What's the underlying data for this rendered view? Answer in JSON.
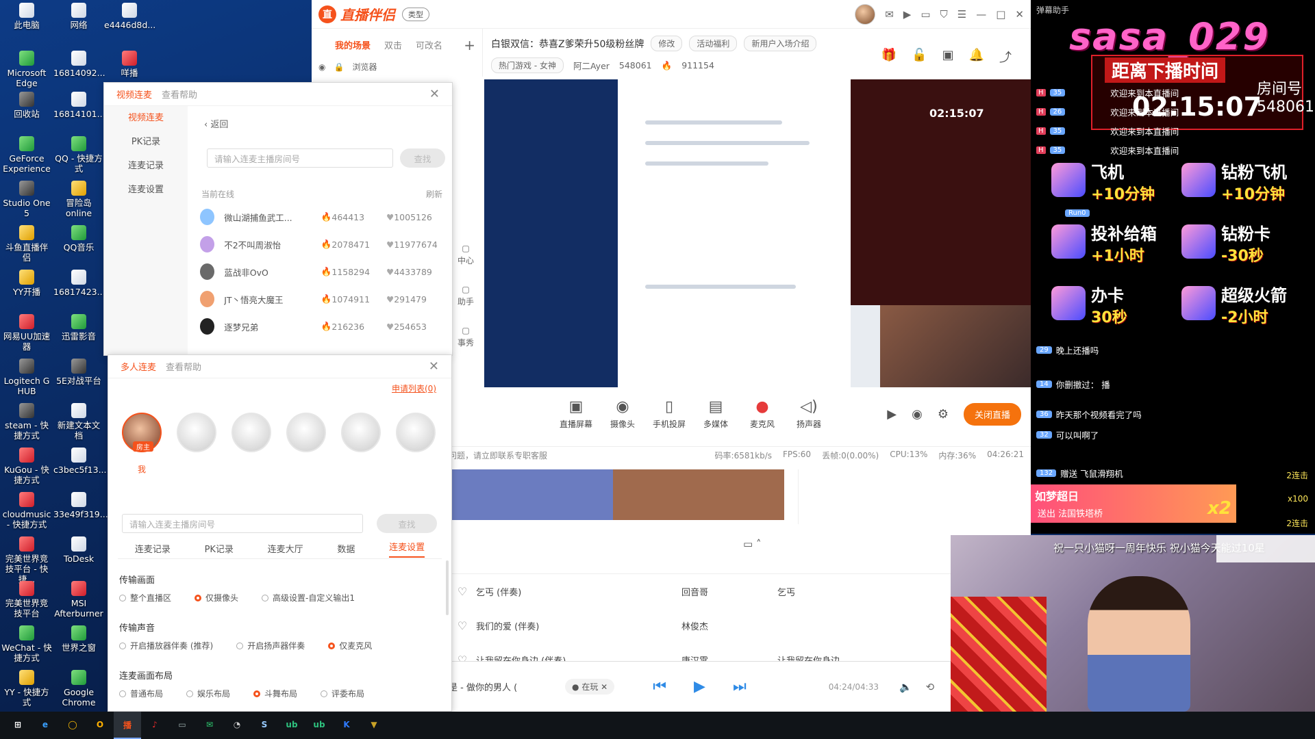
{
  "desktop": {
    "icons": [
      {
        "label": "此电脑",
        "glyph": "💻"
      },
      {
        "label": "网络",
        "glyph": "🌐"
      },
      {
        "label": "e4446d8d...",
        "glyph": "📄"
      },
      {
        "label": "Microsoft Edge",
        "glyph": "e"
      },
      {
        "label": "16814092...",
        "glyph": "📄"
      },
      {
        "label": "咩播",
        "glyph": "🎬"
      },
      {
        "label": "回收站",
        "glyph": "🗑"
      },
      {
        "label": "16814101...",
        "glyph": "📄"
      },
      {
        "label": "GeForce Experience",
        "glyph": "◆"
      },
      {
        "label": "QQ - 快捷方式",
        "glyph": "🐧"
      },
      {
        "label": "Studio One 5",
        "glyph": "◉"
      },
      {
        "label": "冒险岛online",
        "glyph": "⚔"
      },
      {
        "label": "斗鱼直播伴侣",
        "glyph": "🐟"
      },
      {
        "label": "QQ音乐",
        "glyph": "♫"
      },
      {
        "label": "YY开播",
        "glyph": "Y"
      },
      {
        "label": "16817423...",
        "glyph": "📄"
      },
      {
        "label": "网易UU加速器",
        "glyph": "U"
      },
      {
        "label": "迅雷影音",
        "glyph": "▶"
      },
      {
        "label": "Logitech G HUB",
        "glyph": "G"
      },
      {
        "label": "5E对战平台",
        "glyph": "5"
      },
      {
        "label": "steam - 快捷方式",
        "glyph": "S"
      },
      {
        "label": "新建文本文档",
        "glyph": "📄"
      },
      {
        "label": "KuGou - 快捷方式",
        "glyph": "K"
      },
      {
        "label": "c3bec5f13...",
        "glyph": "📄"
      },
      {
        "label": "cloudmusic - 快捷方式",
        "glyph": "♪"
      },
      {
        "label": "33e49f319...",
        "glyph": "📄"
      },
      {
        "label": "完美世界竞技平台 - 快捷...",
        "glyph": "W"
      },
      {
        "label": "ToDesk",
        "glyph": "T"
      },
      {
        "label": "完美世界竞技平台",
        "glyph": "W"
      },
      {
        "label": "MSI Afterburner",
        "glyph": "M"
      },
      {
        "label": "WeChat - 快捷方式",
        "glyph": "W"
      },
      {
        "label": "世界之窗",
        "glyph": "◎"
      },
      {
        "label": "YY - 快捷方式",
        "glyph": "Y"
      },
      {
        "label": "Google Chrome",
        "glyph": "◯"
      }
    ]
  },
  "taskbar": {
    "items": [
      {
        "glyph": "⊞",
        "name": "start-button"
      },
      {
        "glyph": "e",
        "name": "taskbar-edge"
      },
      {
        "glyph": "◯",
        "name": "taskbar-chrome"
      },
      {
        "glyph": "O",
        "name": "taskbar-obs"
      },
      {
        "glyph": "播",
        "name": "taskbar-zhibo"
      },
      {
        "glyph": "♪",
        "name": "taskbar-netease-music"
      },
      {
        "glyph": "▭",
        "name": "taskbar-window"
      },
      {
        "glyph": "✉",
        "name": "taskbar-wechat"
      },
      {
        "glyph": "◔",
        "name": "taskbar-clock-app"
      },
      {
        "glyph": "S",
        "name": "taskbar-steam"
      },
      {
        "glyph": "ub",
        "name": "taskbar-uu-1"
      },
      {
        "glyph": "ub",
        "name": "taskbar-uu-2"
      },
      {
        "glyph": "K",
        "name": "taskbar-kugou"
      },
      {
        "glyph": "▼",
        "name": "taskbar-game"
      }
    ]
  },
  "app": {
    "logo_text": "直播伴侣",
    "type_btn": "类型",
    "scene_tabs": [
      "我的场景",
      "双击",
      "可改名"
    ],
    "scene_row_label": "浏览器",
    "room_title": "白银双信：恭喜Z爹荣升50级粉丝牌",
    "edit_btn": "修改",
    "activity_btn": "活动福利",
    "newuser_btn": "新用户入场介绍",
    "category": "热门游戏 - 女神",
    "host_name": "阿二Ayer",
    "room_id": "548061",
    "popularity": "911154",
    "side_tools": [
      "中心",
      "助手",
      "事秀"
    ],
    "tools": [
      {
        "label": "直播屏幕",
        "glyph": "▣"
      },
      {
        "label": "摄像头",
        "glyph": "◉"
      },
      {
        "label": "手机投屏",
        "glyph": "▯"
      },
      {
        "label": "多媒体",
        "glyph": "▤"
      },
      {
        "label": "麦克风",
        "glyph": "●"
      },
      {
        "label": "扬声器",
        "glyph": "◁)"
      }
    ],
    "end_live": "关闭直播",
    "status_msg": "问题，请立即联系专职客服",
    "status": {
      "bitrate": "码率:6581kb/s",
      "fps": "FPS:60",
      "drop": "丢帧:0(0.00%)",
      "cpu": "CPU:13%",
      "mem": "内存:36%",
      "time": "04:26:21"
    },
    "songs": [
      {
        "name": "乞丐 (伴奏)",
        "artist": "回音哥",
        "album": "乞丐"
      },
      {
        "name": "我们的爱 (伴奏)",
        "artist": "林俊杰",
        "album": ""
      },
      {
        "name": "让我留在你身边 (伴奏)",
        "artist": "唐汉霄",
        "album": "让我留在你身边"
      }
    ],
    "player": {
      "title": "是 - 做你的男人 (",
      "user": "在玩",
      "time": "04:24/04:33"
    }
  },
  "video_link": {
    "title": "视频连麦",
    "help": "查看帮助",
    "nav": [
      "视频连麦",
      "PK记录",
      "连麦记录",
      "连麦设置"
    ],
    "back": "返回",
    "search_placeholder": "请输入连麦主播房间号",
    "search_btn": "查找",
    "online_label": "当前在线",
    "refresh": "刷新",
    "anchors": [
      {
        "name": "微山湖捕鱼武工...",
        "fans": "464413",
        "likes": "1005126",
        "color": "#8ec5ff"
      },
      {
        "name": "不2不叫周淑怡",
        "fans": "2078471",
        "likes": "11977674",
        "color": "#c3a0e8"
      },
      {
        "name": "蓝战非OvO",
        "fans": "1158294",
        "likes": "4433789",
        "color": "#6a6a6a"
      },
      {
        "name": "JT丶悟亮大魔王",
        "fans": "1074911",
        "likes": "291479",
        "color": "#f0a070"
      },
      {
        "name": "逐梦兄弟",
        "fans": "216236",
        "likes": "254653",
        "color": "#222"
      }
    ]
  },
  "multi_link": {
    "title": "多人连麦",
    "help": "查看帮助",
    "request_list": "申请列表(0)",
    "host_badge": "房主",
    "me_label": "我",
    "search_placeholder": "请输入连麦主播房间号",
    "search_btn": "查找",
    "tabs": [
      "连麦记录",
      "PK记录",
      "连麦大厅",
      "数据",
      "连麦设置"
    ],
    "sections": [
      {
        "title": "传输画面",
        "options": [
          "整个直播区",
          "仅摄像头",
          "高级设置-自定义输出1"
        ],
        "selected": 1
      },
      {
        "title": "传输声音",
        "options": [
          "开启播放器伴奏 (推荐)",
          "开启扬声器伴奏",
          "仅麦克风"
        ],
        "selected": 2
      },
      {
        "title": "连麦画面布局",
        "options": [
          "普通布局",
          "娱乐布局",
          "斗舞布局",
          "评委布局"
        ],
        "selected": 2
      }
    ]
  },
  "danmaku": {
    "title": "弹幕助手",
    "overlay_name": "sasa_029",
    "timer_label": "距离下播时间",
    "room_label": "房间号",
    "room_num": "548061",
    "timer": "02:15:07",
    "messages": [
      {
        "lv": "35",
        "text": "欢迎来到本直播间"
      },
      {
        "lv": "26",
        "text": "欢迎来到本直播间"
      },
      {
        "lv": "35",
        "text": "欢迎来到本直播间"
      },
      {
        "lv": "35",
        "text": "欢迎来到本直播间"
      }
    ],
    "gifts": [
      {
        "name": "飞机",
        "time": "+10分钟"
      },
      {
        "name": "钻粉飞机",
        "time": "+10分钟"
      },
      {
        "name": "投补给箱",
        "time": "+1小时"
      },
      {
        "name": "钻粉卡",
        "time": "-30秒"
      },
      {
        "name": "办卡",
        "time": "30秒"
      },
      {
        "name": "超级火箭",
        "time": "-2小时"
      }
    ],
    "user_run": "Run0",
    "chat": [
      {
        "lv": "29",
        "text": "晚上还播吗"
      },
      {
        "lv": "14",
        "text": "你删撤过：  播"
      },
      {
        "lv": "36",
        "text": "昨天那个视频看完了吗"
      },
      {
        "lv": "32",
        "text": "可以叫啊了"
      },
      {
        "lv": "132",
        "text": "赠送 飞鼠滑翔机"
      }
    ],
    "combo": [
      "2连击",
      "x100",
      "2连击"
    ],
    "send_title": "如梦超日",
    "send_sub": "送出  法国铁塔桥",
    "send_x": "x2"
  },
  "webcam": {
    "banner": "祝一只小猫呀一周年快乐 祝小猫今天能过10星"
  }
}
